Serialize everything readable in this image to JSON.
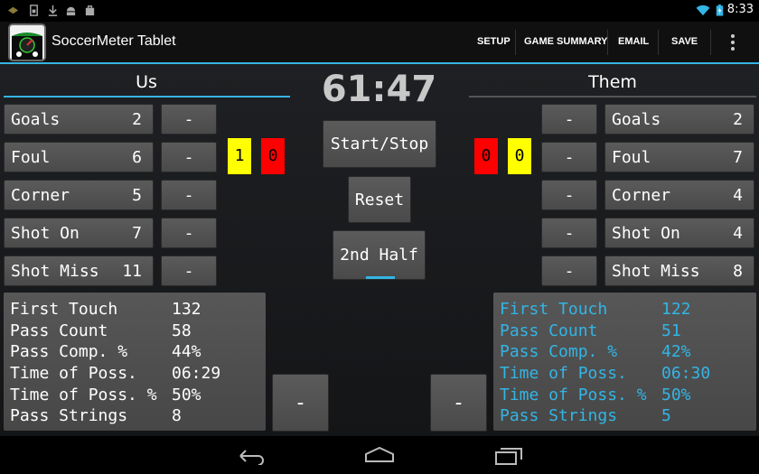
{
  "status_bar": {
    "time": "8:33"
  },
  "action_bar": {
    "title": "SoccerMeter Tablet",
    "actions": [
      "SETUP",
      "GAME SUMMARY",
      "EMAIL",
      "SAVE"
    ]
  },
  "timer": "61:47",
  "controls": {
    "start_stop": "Start/Stop",
    "reset": "Reset",
    "half": "2nd Half"
  },
  "minus_label": "-",
  "us": {
    "title": "Us",
    "stats": [
      {
        "label": "Goals",
        "value": "2"
      },
      {
        "label": "Foul",
        "value": "6"
      },
      {
        "label": "Corner",
        "value": "5"
      },
      {
        "label": "Shot On",
        "value": "7"
      },
      {
        "label": "Shot Miss",
        "value": "11"
      }
    ],
    "cards": {
      "yellow": "1",
      "red": "0"
    },
    "panel": [
      {
        "label": "First Touch",
        "value": "132"
      },
      {
        "label": "Pass Count",
        "value": "58"
      },
      {
        "label": "Pass Comp. %",
        "value": "44%"
      },
      {
        "label": "Time of Poss.",
        "value": "06:29"
      },
      {
        "label": "Time of Poss. %",
        "value": "50%"
      },
      {
        "label": "Pass Strings",
        "value": "8"
      }
    ]
  },
  "them": {
    "title": "Them",
    "stats": [
      {
        "label": "Goals",
        "value": "2"
      },
      {
        "label": "Foul",
        "value": "7"
      },
      {
        "label": "Corner",
        "value": "4"
      },
      {
        "label": "Shot On",
        "value": "4"
      },
      {
        "label": "Shot Miss",
        "value": "8"
      }
    ],
    "cards": {
      "red": "0",
      "yellow": "0"
    },
    "panel": [
      {
        "label": "First Touch",
        "value": "122"
      },
      {
        "label": "Pass Count",
        "value": "51"
      },
      {
        "label": "Pass Comp. %",
        "value": "42%"
      },
      {
        "label": "Time of Poss.",
        "value": "06:30"
      },
      {
        "label": "Time of Poss. %",
        "value": "50%"
      },
      {
        "label": "Pass Strings",
        "value": "5"
      }
    ]
  },
  "colors": {
    "accent": "#33b5e5",
    "them_text": "#33b5e5",
    "yellow_card": "#ffff00",
    "red_card": "#ff0000"
  }
}
